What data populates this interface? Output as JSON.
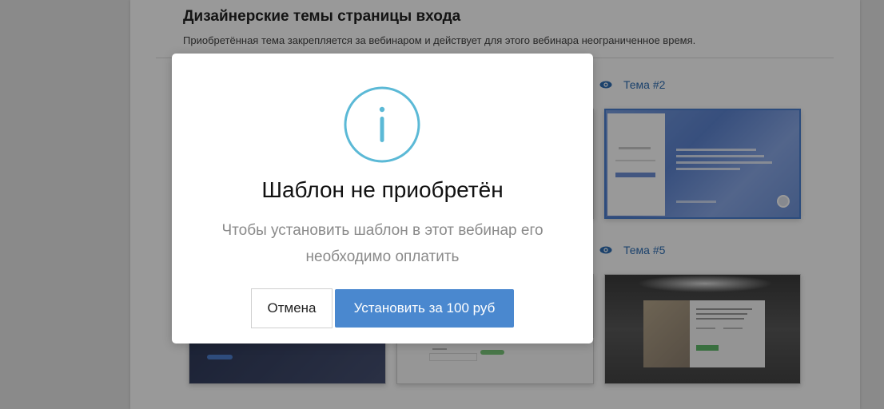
{
  "section": {
    "title": "Дизайнерские темы страницы входа",
    "subtitle": "Приобретённая тема закрепляется за вебинаром и действует для этого вебинара неограниченное время."
  },
  "themes": [
    {
      "label": "Тема #2",
      "icon": "eye-icon"
    },
    {
      "label": "Тема #5",
      "icon": "eye-icon"
    }
  ],
  "modal": {
    "icon": "info-icon",
    "accent_color": "#5bb9d6",
    "title": "Шаблон не приобретён",
    "message": "Чтобы установить шаблон в этот вебинар его необходимо оплатить",
    "cancel_label": "Отмена",
    "install_label": "Установить за 100 руб",
    "install_color": "#4a88cf"
  }
}
